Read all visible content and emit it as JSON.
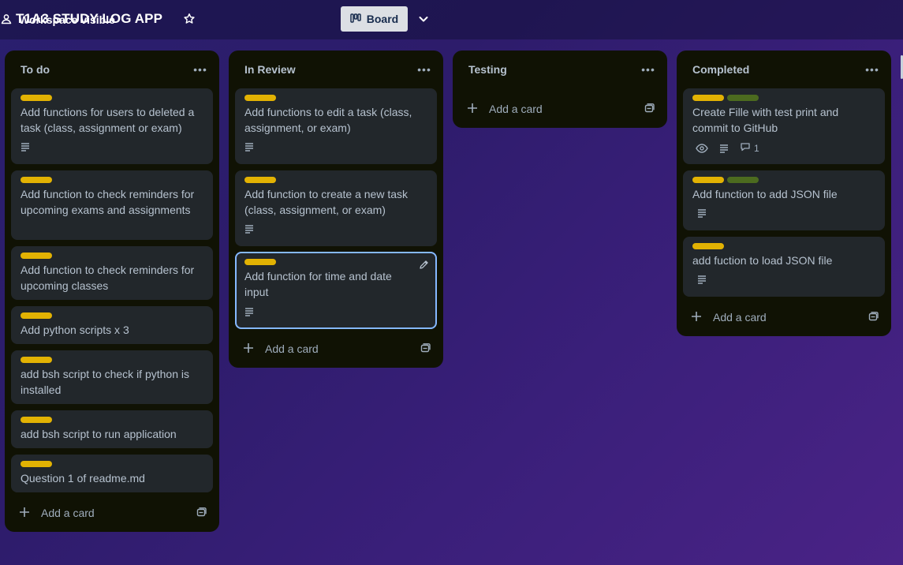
{
  "header": {
    "board_title": "T1A3 STUDY LOG APP",
    "visibility_label": "Workspace visible",
    "view_label": "Board"
  },
  "colors": {
    "label_yellow": "#e2b203",
    "label_green": "#4c6b1f",
    "card_bg": "#22272b",
    "list_bg": "#101204",
    "active_border": "#85b8ff"
  },
  "lists": [
    {
      "title": "To do",
      "add_card_label": "Add a card",
      "cards": [
        {
          "text": "Add functions for users to deleted a task (class, assignment or exam)"
        },
        {
          "text": "Add function to check reminders for upcoming exams and assignments"
        },
        {
          "text": "Add function to check reminders for upcoming classes"
        },
        {
          "text": "Add python scripts x 3"
        },
        {
          "text": "add bsh script to check if python is installed"
        },
        {
          "text": "add bsh script to run application"
        },
        {
          "text": "Question 1 of readme.md"
        }
      ]
    },
    {
      "title": "In Review",
      "add_card_label": "Add a card",
      "cards": [
        {
          "text": "Add functions to edit a task (class, assignment, or exam)"
        },
        {
          "text": "Add function to create a new task (class, assignment, or exam)"
        },
        {
          "text": "Add function for time and date input"
        }
      ]
    },
    {
      "title": "Testing",
      "add_card_label": "Add a card",
      "cards": []
    },
    {
      "title": "Completed",
      "add_card_label": "Add a card",
      "cards": [
        {
          "text": "Create Fille with test print and commit to GitHub",
          "comment_count": "1"
        },
        {
          "text": "Add function to add JSON file"
        },
        {
          "text": "add fuction to load JSON file"
        }
      ]
    }
  ]
}
